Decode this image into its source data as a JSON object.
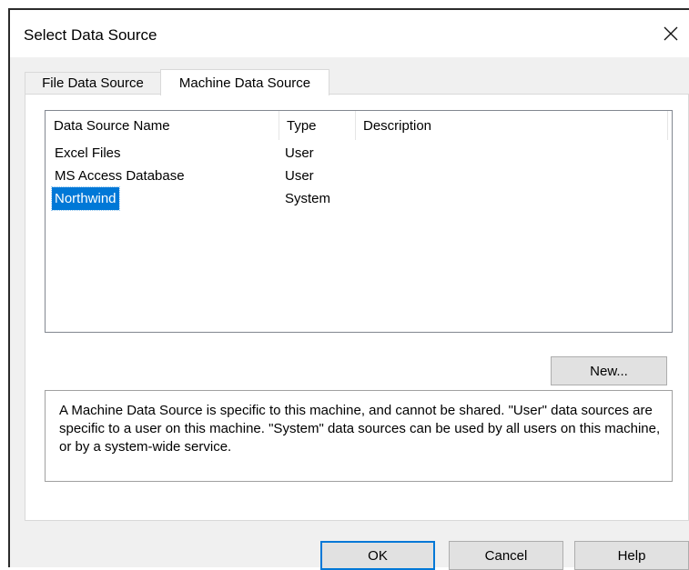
{
  "dialog": {
    "title": "Select Data Source",
    "close_glyph": "✕"
  },
  "tabs": [
    {
      "label": "File Data Source",
      "active": false
    },
    {
      "label": "Machine Data Source",
      "active": true
    }
  ],
  "list": {
    "columns": [
      "Data Source Name",
      "Type",
      "Description"
    ],
    "rows": [
      {
        "name": "Excel Files",
        "type": "User",
        "description": "",
        "selected": false
      },
      {
        "name": "MS Access Database",
        "type": "User",
        "description": "",
        "selected": false
      },
      {
        "name": "Northwind",
        "type": "System",
        "description": "",
        "selected": true
      }
    ]
  },
  "buttons": {
    "new_label": "New...",
    "ok_label": "OK",
    "cancel_label": "Cancel",
    "help_label": "Help"
  },
  "description_text": "A Machine Data Source is specific to this machine, and cannot be shared. \"User\" data sources are specific to a user on this machine. \"System\" data sources can be used by all users on this machine, or by a system-wide service.",
  "colors": {
    "selection": "#0078d7",
    "dialog_bg": "#f0f0f0",
    "button_bg": "#e1e1e1"
  },
  "icons": {
    "close": "close-icon"
  }
}
